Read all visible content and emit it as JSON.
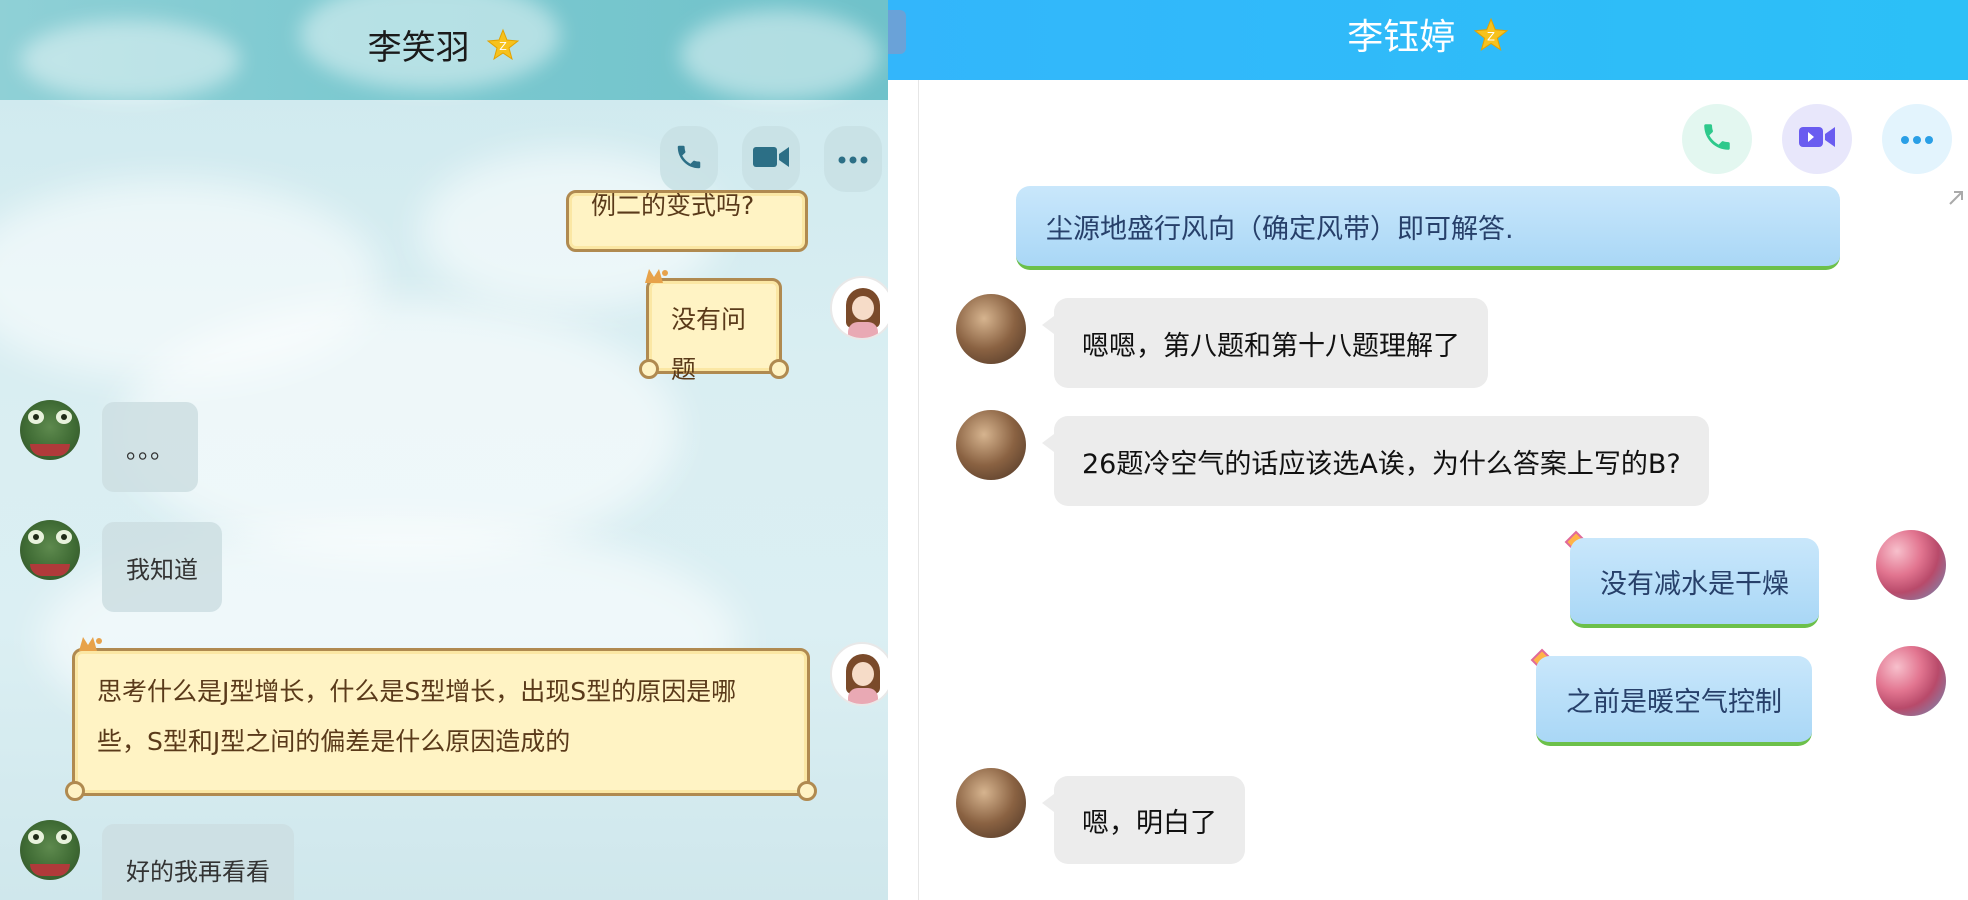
{
  "left": {
    "title": "李笑羽",
    "actions": [
      "phone-icon",
      "video-icon",
      "more-icon"
    ],
    "messages": {
      "partial_top": "例二的变式吗?",
      "m1": "没有问题",
      "m2": "。。。",
      "m3": "我知道",
      "m4": "思考什么是J型增长，什么是S型增长，出现S型的原因是哪些，S型和J型之间的偏差是什么原因造成的",
      "m5": "好的我再看看"
    }
  },
  "right": {
    "title": "李钰婷",
    "actions": [
      "phone-icon",
      "video-icon",
      "more-icon"
    ],
    "messages": {
      "partial_top": "尘源地盛行风向（确定风带）即可解答.",
      "m1": "嗯嗯，第八题和第十八题理解了",
      "m2": "26题冷空气的话应该选A诶，为什么答案上写的B?",
      "m3": "没有减水是干燥",
      "m4": "之前是暖空气控制",
      "m5": "嗯，明白了"
    }
  },
  "colors": {
    "right_header": "#33b6fb",
    "left_header": "#7cc9d0",
    "scroll_bubble": "#fff3c4",
    "blue_bubble": "#b3dcf8",
    "grey_bubble": "#ececec"
  }
}
